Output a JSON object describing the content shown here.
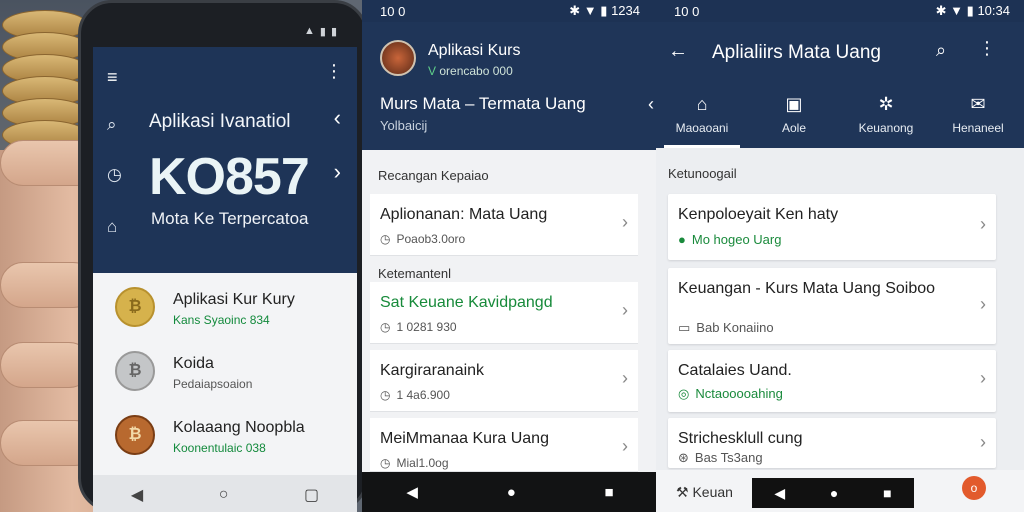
{
  "phone1": {
    "title": "Aplikasi Ivanatiol",
    "big_value": "KO857",
    "subtitle": "Mota Ke Terpercatoa",
    "items": [
      {
        "name": "Aplikasi Kur Kury",
        "meta": "Kans Syaoinc 834"
      },
      {
        "name": "Koida",
        "meta": "Pedaiapsoaion"
      },
      {
        "name": "Kolaaang Noopbla",
        "meta": "Koonentulaic 038"
      }
    ]
  },
  "panel2": {
    "status_time": "10 0",
    "status_right": "1234",
    "header_title": "Aplikasi Kurs",
    "header_sub_icon": "V",
    "header_sub": "orencabo 000",
    "header_title2": "Murs Mata – Termata Uang",
    "header_title2_sub": "Yolbaicij",
    "section1": "Recangan Kepaiao",
    "section2": "Ketemantenl",
    "cards": [
      {
        "name": "Aplionanan: Mata Uang",
        "meta": "Poaob3.0oro"
      },
      {
        "name": "Sat Keuane Kavidpangd",
        "meta": "1 0281 930"
      },
      {
        "name": "Kargiraranaink",
        "meta": "1 4a6.900"
      },
      {
        "name": "MeiMmanaa Kura Uang",
        "meta": "Mial1.0og"
      }
    ]
  },
  "panel3": {
    "status_time": "10 0",
    "status_right": "10:34",
    "title": "Aplialiirs Mata Uang",
    "tabs": [
      {
        "label": "Maoaoani",
        "icon": "home-icon"
      },
      {
        "label": "Aole",
        "icon": "image-icon"
      },
      {
        "label": "Keuanong",
        "icon": "gear-icon"
      },
      {
        "label": "Henaneel",
        "icon": "mail-icon"
      }
    ],
    "section": "Ketunoogail",
    "cards": [
      {
        "name": "Kenpoloeyait Ken haty",
        "meta": "Mo hogeo Uarg"
      },
      {
        "name": "Keuangan - Kurs Mata Uang Soiboo",
        "meta": "Bab Konaiino"
      },
      {
        "name": "Catalaies Uand.",
        "meta": "Nctaooooahing"
      },
      {
        "name": "Strichesklull cung",
        "meta": "Bas Ts3ang"
      }
    ],
    "bottom_label": "Keuan",
    "fab": "o"
  },
  "colors": {
    "header_navy": "#1f3558",
    "accent_green": "#178a3a",
    "fab_orange": "#e25a2c"
  }
}
